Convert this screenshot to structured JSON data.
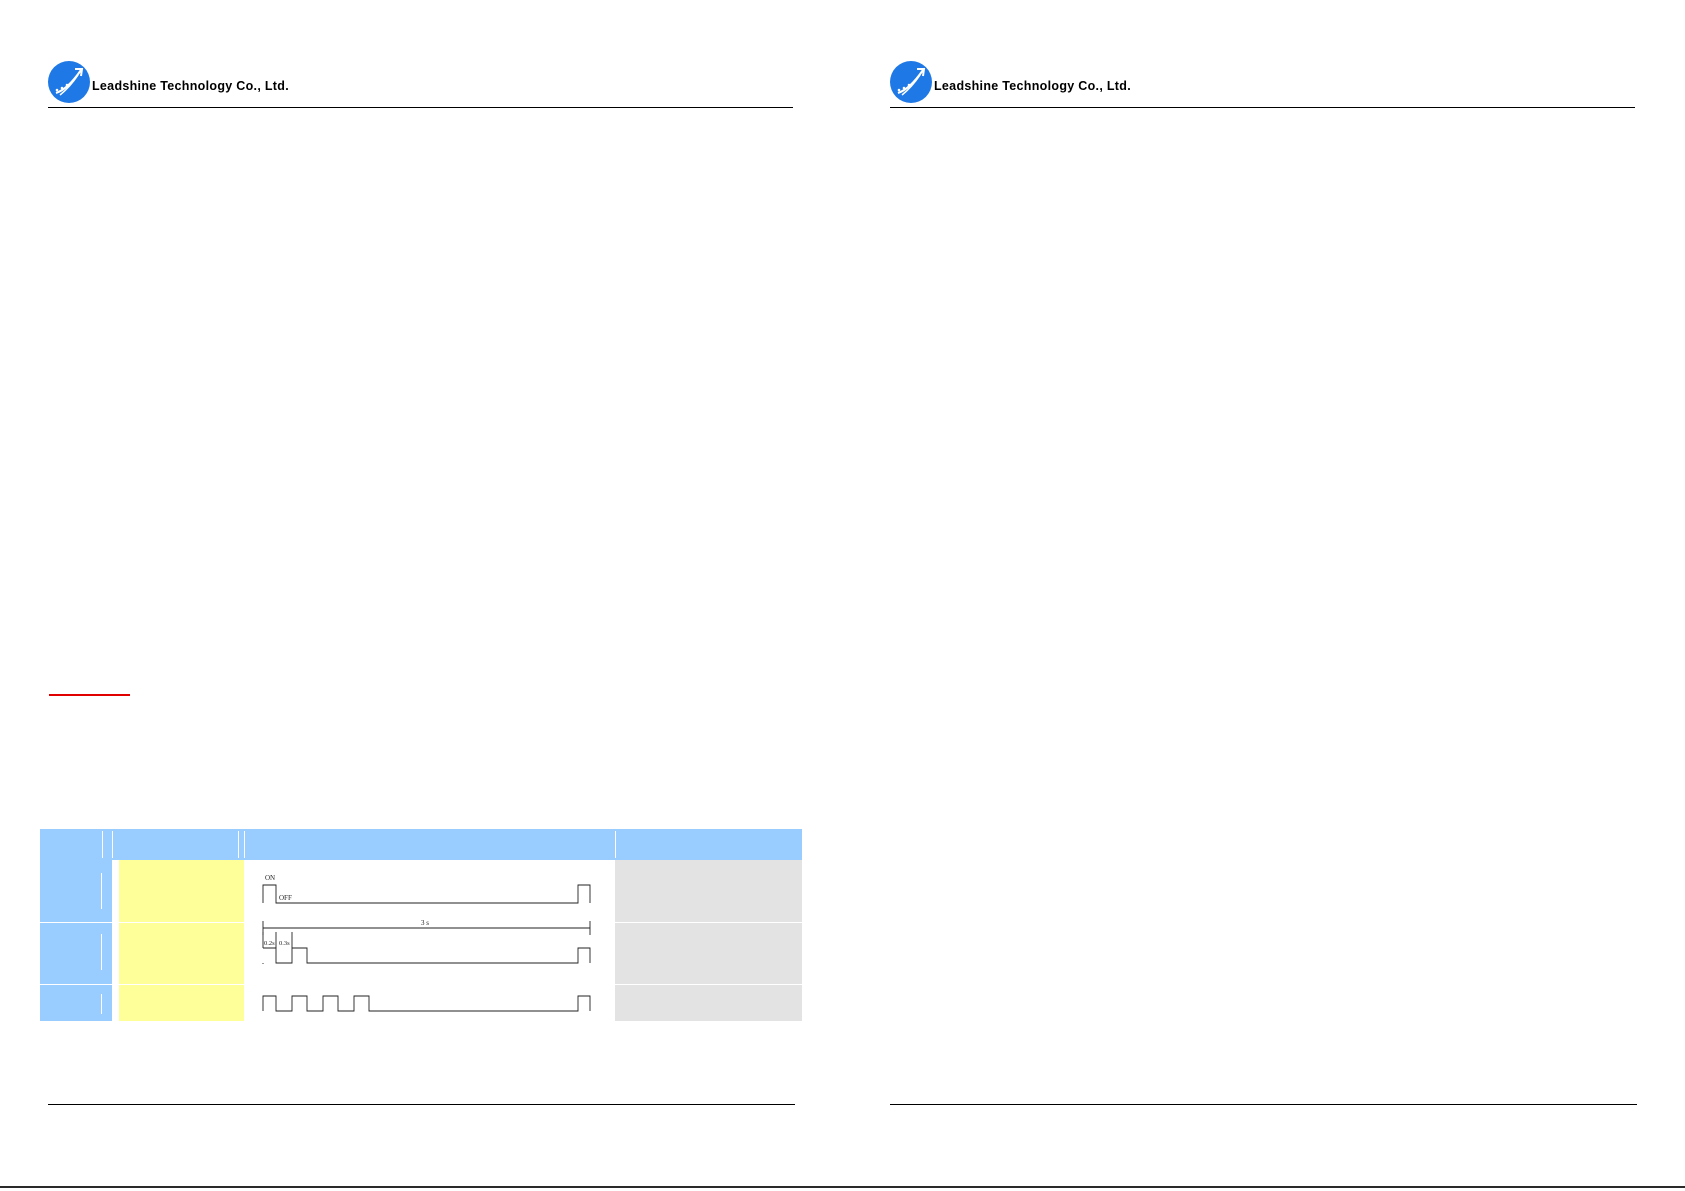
{
  "header": {
    "company_name": "Leadshine Technology Co., Ltd.",
    "logo_color": "#1e78e6"
  },
  "colors": {
    "table_header": "#99ccff",
    "yellow_column": "#ffff99",
    "grey_column": "#e3e3e3",
    "accent_red": "#e00000"
  },
  "timing": {
    "on_label": "ON",
    "off_label": "OFF",
    "period_label": "3 s",
    "high_label": "0.2s",
    "low_label": "0.3s"
  }
}
